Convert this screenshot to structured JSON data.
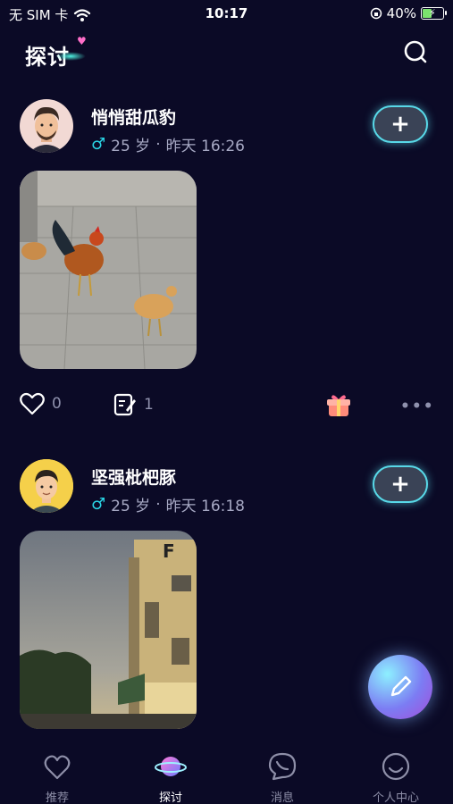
{
  "status_bar": {
    "carrier": "无 SIM 卡",
    "time": "10:17",
    "battery": "40%"
  },
  "header": {
    "title": "探讨"
  },
  "posts": [
    {
      "username": "悄悄甜瓜豹",
      "age": "25 岁",
      "separator": "·",
      "time": "昨天 16:26",
      "likes": "0",
      "comments": "1"
    },
    {
      "username": "坚强枇杷豚",
      "age": "25 岁",
      "separator": "·",
      "time": "昨天 16:18"
    }
  ],
  "tabbar": {
    "items": [
      {
        "label": "推荐"
      },
      {
        "label": "探讨"
      },
      {
        "label": "消息"
      },
      {
        "label": "个人中心"
      }
    ]
  },
  "icons": {
    "follow": "plus-icon",
    "fab": "pencil-icon",
    "search": "search-icon",
    "like": "heart-icon",
    "comment": "edit-note-icon",
    "gift": "gift-icon",
    "more": "more-icon"
  },
  "colors": {
    "background": "#0b0a26",
    "accent": "#58d9e8",
    "male": "#2ad5e6"
  }
}
